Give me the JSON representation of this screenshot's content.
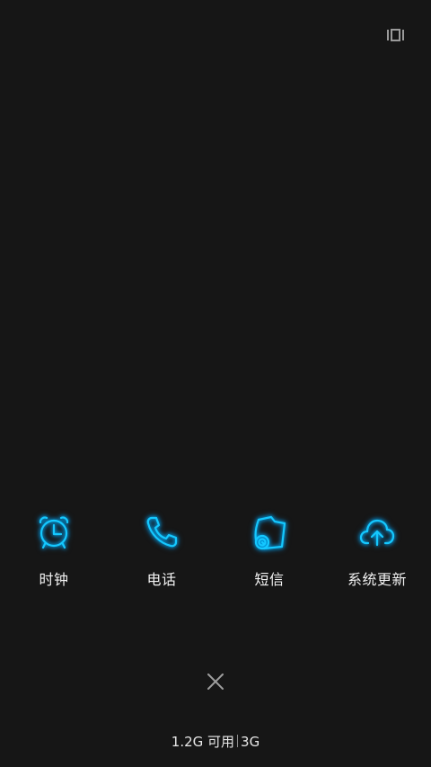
{
  "header": {
    "multiwindow_icon": "multiwindow-icon"
  },
  "apps": [
    {
      "label": "时钟",
      "icon": "alarm-clock-icon"
    },
    {
      "label": "电话",
      "icon": "phone-icon"
    },
    {
      "label": "短信",
      "icon": "message-icon"
    },
    {
      "label": "系统更新",
      "icon": "cloud-upload-icon"
    }
  ],
  "close": {
    "icon": "close-icon"
  },
  "memory": {
    "available": "1.2G 可用",
    "total": "3G"
  },
  "colors": {
    "background": "#161616",
    "icon_glow": "#00b4ff",
    "text": "#f2f2f2"
  }
}
